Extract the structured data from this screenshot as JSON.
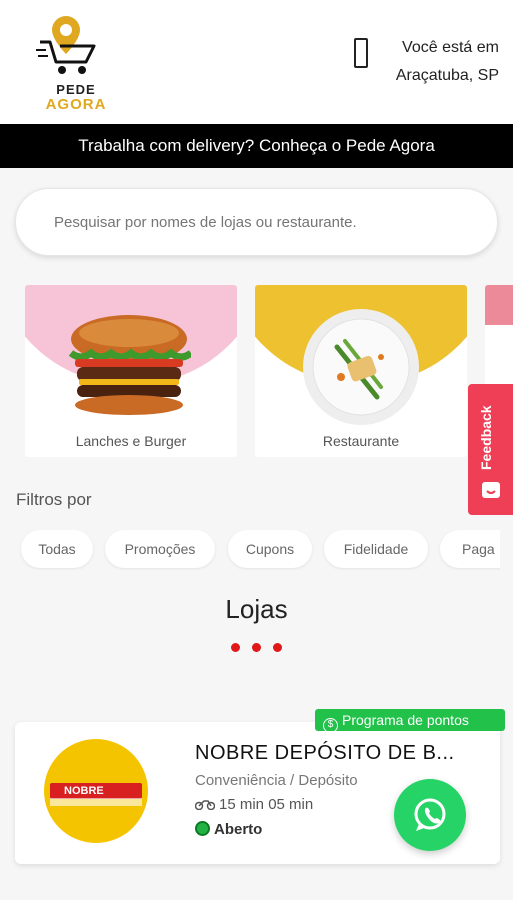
{
  "header": {
    "logo_line1": "PEDE",
    "logo_line2": "AGORA",
    "location_line1": "Você está em",
    "location_line2": "Araçatuba, SP",
    "location_icon": "phone-icon"
  },
  "banner": {
    "text": "Trabalha com delivery? Conheça o Pede Agora"
  },
  "search": {
    "placeholder": "Pesquisar por nomes de lojas ou restaurante."
  },
  "categories": [
    {
      "label": "Lanches e Burger",
      "color": "#f6c4d6",
      "icon": "burger-image"
    },
    {
      "label": "Restaurante",
      "color": "#edc12f",
      "icon": "plate-image"
    }
  ],
  "feedback": {
    "label": "Feedback",
    "color": "#ee3f56"
  },
  "filters": {
    "title": "Filtros por",
    "chips": [
      "Todas",
      "Promoções",
      "Cupons",
      "Fidelidade",
      "Paga"
    ]
  },
  "lojas": {
    "title": "Lojas"
  },
  "store": {
    "badge": "Programa de pontos",
    "name": "NOBRE DEPÓSITO DE B...",
    "category": "Conveniência / Depósito",
    "times": "15 min  05 min",
    "status": "Aberto",
    "logo_text": "NOBRE"
  },
  "colors": {
    "accent": "#e01818",
    "green": "#22c24a",
    "whatsapp": "#25d366"
  }
}
